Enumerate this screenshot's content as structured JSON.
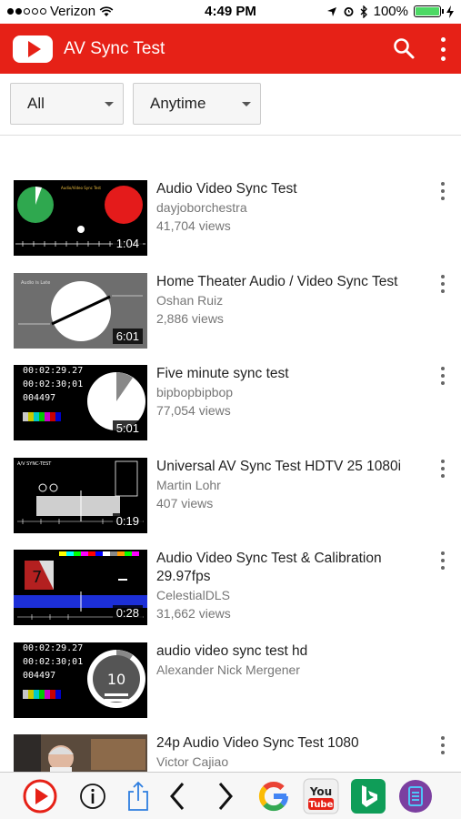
{
  "status_bar": {
    "carrier": "Verizon",
    "time": "4:49 PM",
    "battery": "100%",
    "battery_level": 1.0
  },
  "app_bar": {
    "title": "AV Sync Test",
    "icons": [
      "youtube-logo-icon",
      "search-icon",
      "more-vertical-icon"
    ]
  },
  "filters": {
    "type": "All",
    "date": "Anytime"
  },
  "videos": [
    {
      "title": "Audio Video Sync Test",
      "channel": "dayjoborchestra",
      "views": "41,704 views",
      "duration": "1:04",
      "thumb_text": "Audio/Video Sync Test"
    },
    {
      "title": "Home Theater Audio / Video Sync Test",
      "channel": "Oshan Ruiz",
      "views": "2,886 views",
      "duration": "6:01",
      "thumb_text": "Audio is Late"
    },
    {
      "title": "Five minute sync test",
      "channel": "bipbopbipbop",
      "views": "77,054 views",
      "duration": "5:01",
      "thumb_text": "00:02:29.27"
    },
    {
      "title": "Universal AV Sync Test HDTV 25 1080i",
      "channel": "Martin Lohr",
      "views": "407 views",
      "duration": "0:19",
      "thumb_text": "A/V SYNC-TEST"
    },
    {
      "title": "Audio Video Sync Test & Calibration 29.97fps",
      "channel": "CelestialDLS",
      "views": "31,662 views",
      "duration": "0:28",
      "thumb_text": "7"
    },
    {
      "title": "audio video sync test hd",
      "channel": "Alexander Nick Mergener",
      "views": "",
      "duration": "",
      "thumb_text": "10"
    },
    {
      "title": "24p Audio Video Sync Test 1080",
      "channel": "Victor Cajiao",
      "views": "",
      "duration": "",
      "thumb_text": ""
    }
  ],
  "toolbar": {
    "icons": [
      "youtube-play-icon",
      "info-icon",
      "share-icon",
      "back-icon",
      "forward-icon",
      "google-icon",
      "youtube-app-icon",
      "bing-icon",
      "purple-app-icon"
    ],
    "youtube_label": "You Tube"
  }
}
